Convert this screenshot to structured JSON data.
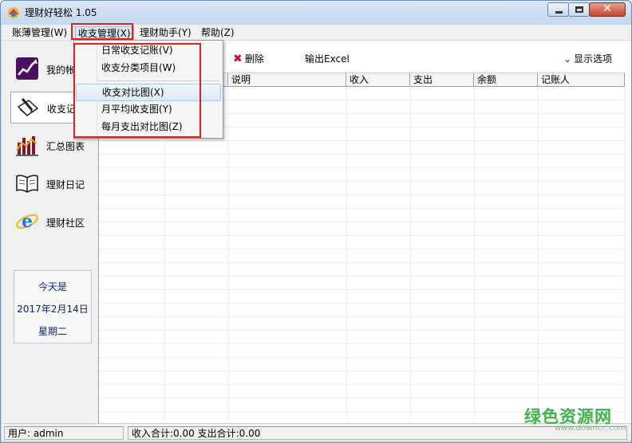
{
  "window": {
    "title": "理财好轻松 1.05"
  },
  "menubar": {
    "items": [
      {
        "label": "账薄管理(W)"
      },
      {
        "label": "收支管理(X)"
      },
      {
        "label": "理财助手(Y)"
      },
      {
        "label": "帮助(Z)"
      }
    ]
  },
  "dropdown": {
    "items": [
      {
        "label": "日常收支记账(V)"
      },
      {
        "label": "收支分类项目(W)"
      },
      {
        "label": "收支对比图(X)"
      },
      {
        "label": "月平均收支图(Y)"
      },
      {
        "label": "每月支出对比图(Z)"
      }
    ]
  },
  "nav": {
    "items": [
      {
        "label": "我的帐",
        "icon": "stock-chart-icon"
      },
      {
        "label": "收支记",
        "icon": "notebook-pen-icon"
      },
      {
        "label": "汇总图表",
        "icon": "bar-chart-icon"
      },
      {
        "label": "理财日记",
        "icon": "open-book-icon"
      },
      {
        "label": "理财社区",
        "icon": "internet-explorer-icon"
      }
    ],
    "date": {
      "line1": "今天是",
      "line2": "2017年2月14日",
      "line3": "星期二"
    }
  },
  "toolbar": {
    "delete_label": "删除",
    "export_label": "输出Excel",
    "options_label": "显示选项"
  },
  "grid": {
    "columns": [
      "说明",
      "收入",
      "支出",
      "余额",
      "记账人"
    ]
  },
  "status": {
    "user": "用户: admin",
    "totals": "收入合计:0.00 支出合计:0.00"
  },
  "watermark": {
    "text": "绿色资源网",
    "sub": "www.downcc.com"
  },
  "colors": {
    "highlight_box": "#e02020",
    "accent": "#1d5fb5",
    "delete_icon": "#c8102e"
  }
}
